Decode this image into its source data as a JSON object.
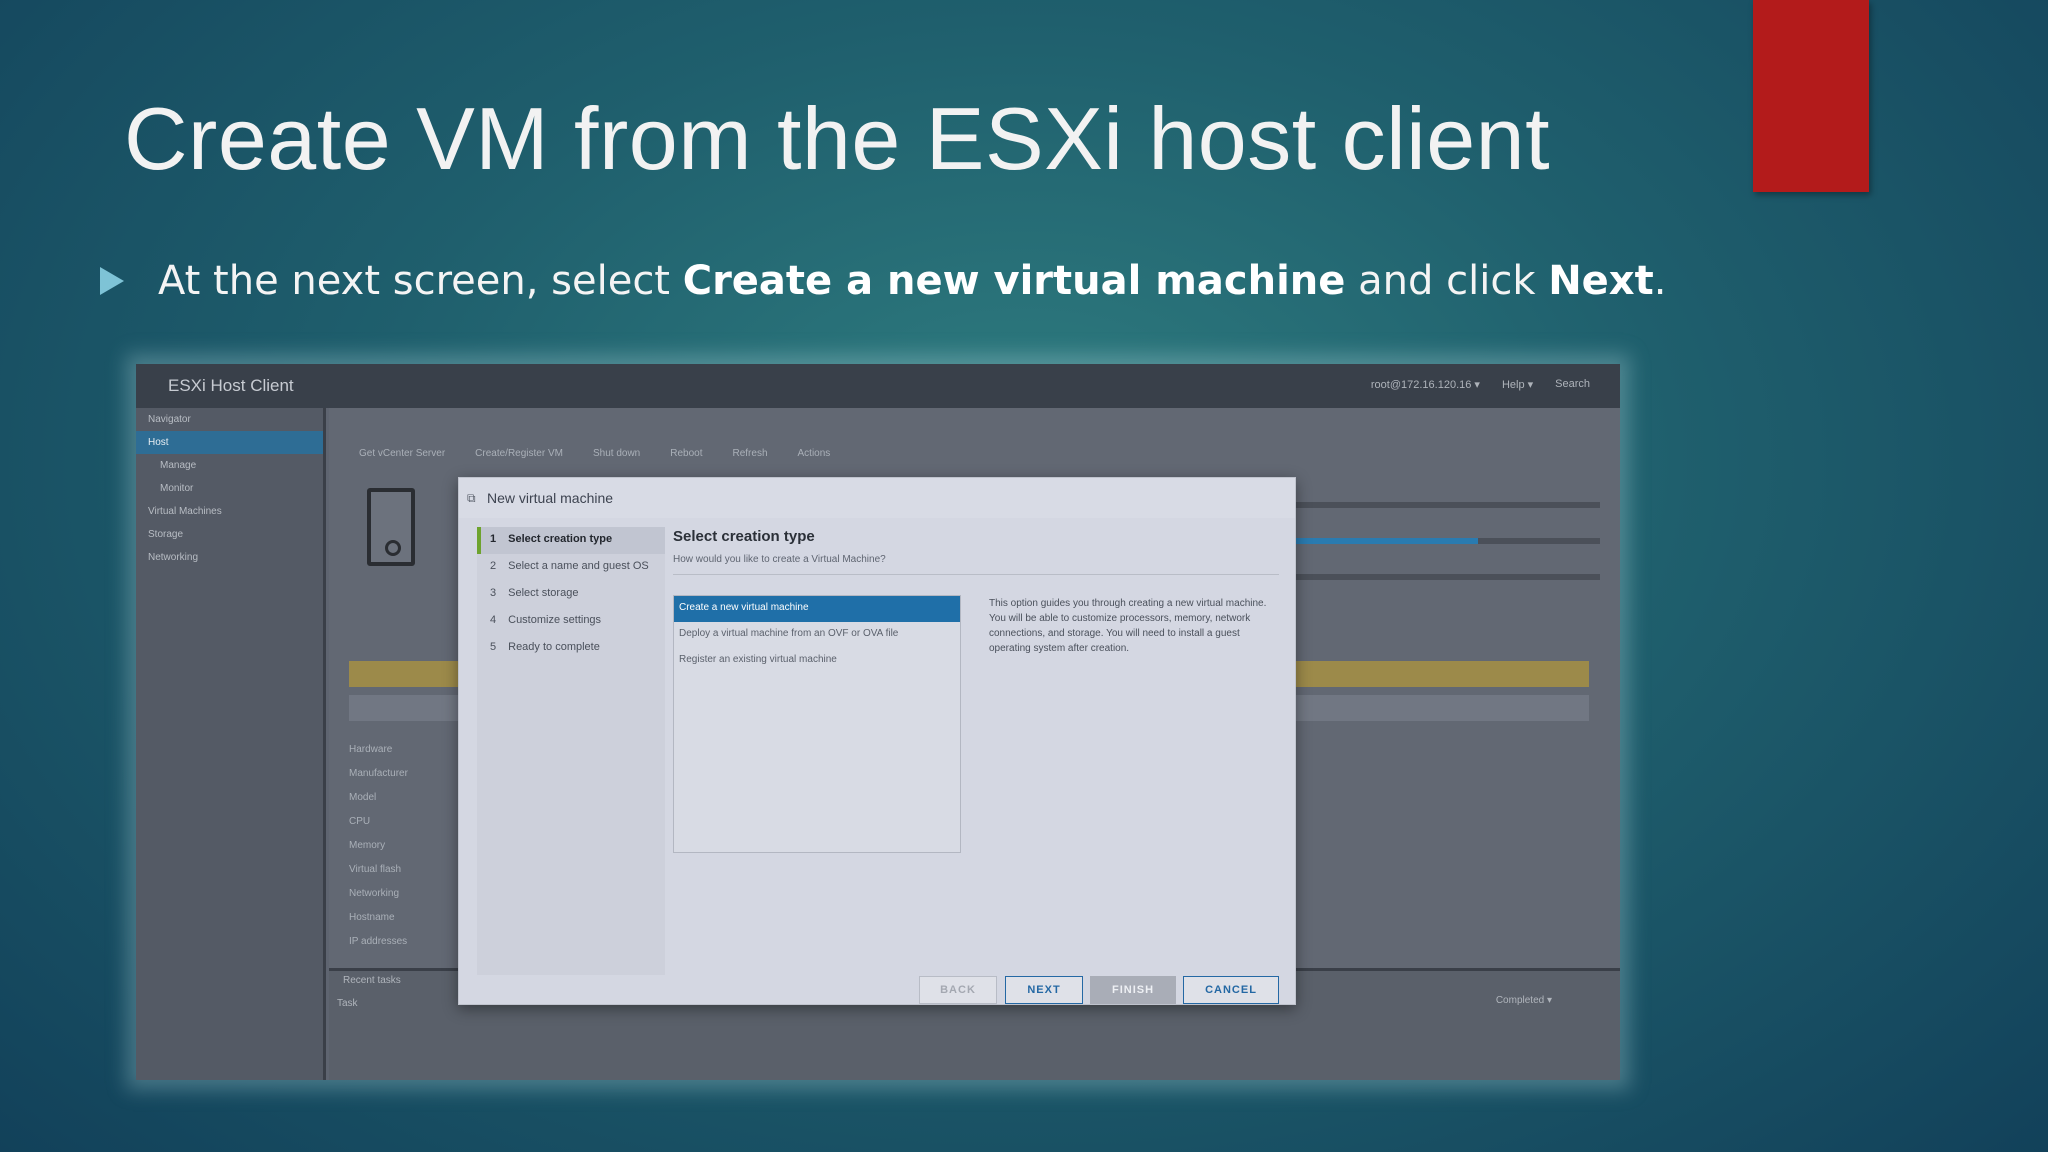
{
  "slide": {
    "title": "Create VM from the ESXi host client",
    "bullet": {
      "prefix": "At the next screen, select ",
      "bold1": "Create a new virtual machine",
      "middle": " and click ",
      "bold2": "Next",
      "suffix": "."
    },
    "accent_color": "#b31b1b"
  },
  "esxi": {
    "app_name": "ESXi Host Client",
    "header_right": [
      "root@172.16.120.16 ▾",
      "Help ▾",
      "Search"
    ],
    "nav": [
      "Navigator",
      "Host",
      "Manage",
      "Monitor",
      "Virtual Machines",
      "Storage",
      "Networking"
    ],
    "toolbar": [
      "Get vCenter Server",
      "Create/Register VM",
      "Shut down",
      "Reboot",
      "Refresh",
      "Actions"
    ],
    "hardware": [
      "Hardware",
      "Manufacturer",
      "Model",
      "CPU",
      "Memory",
      "Virtual flash",
      "Networking",
      "Hostname",
      "IP addresses"
    ],
    "recent_tasks": "Recent tasks",
    "task_col": "Task",
    "completed": "Completed ▾"
  },
  "dialog": {
    "title": "New virtual machine",
    "steps": [
      {
        "num": "1",
        "label": "Select creation type"
      },
      {
        "num": "2",
        "label": "Select a name and guest OS"
      },
      {
        "num": "3",
        "label": "Select storage"
      },
      {
        "num": "4",
        "label": "Customize settings"
      },
      {
        "num": "5",
        "label": "Ready to complete"
      }
    ],
    "heading": "Select creation type",
    "subheading": "How would you like to create a Virtual Machine?",
    "options": [
      "Create a new virtual machine",
      "Deploy a virtual machine from an OVF or OVA file",
      "Register an existing virtual machine"
    ],
    "description": "This option guides you through creating a new virtual machine. You will be able to customize processors, memory, network connections, and storage. You will need to install a guest operating system after creation.",
    "buttons": {
      "back": "BACK",
      "next": "NEXT",
      "finish": "FINISH",
      "cancel": "CANCEL"
    }
  }
}
